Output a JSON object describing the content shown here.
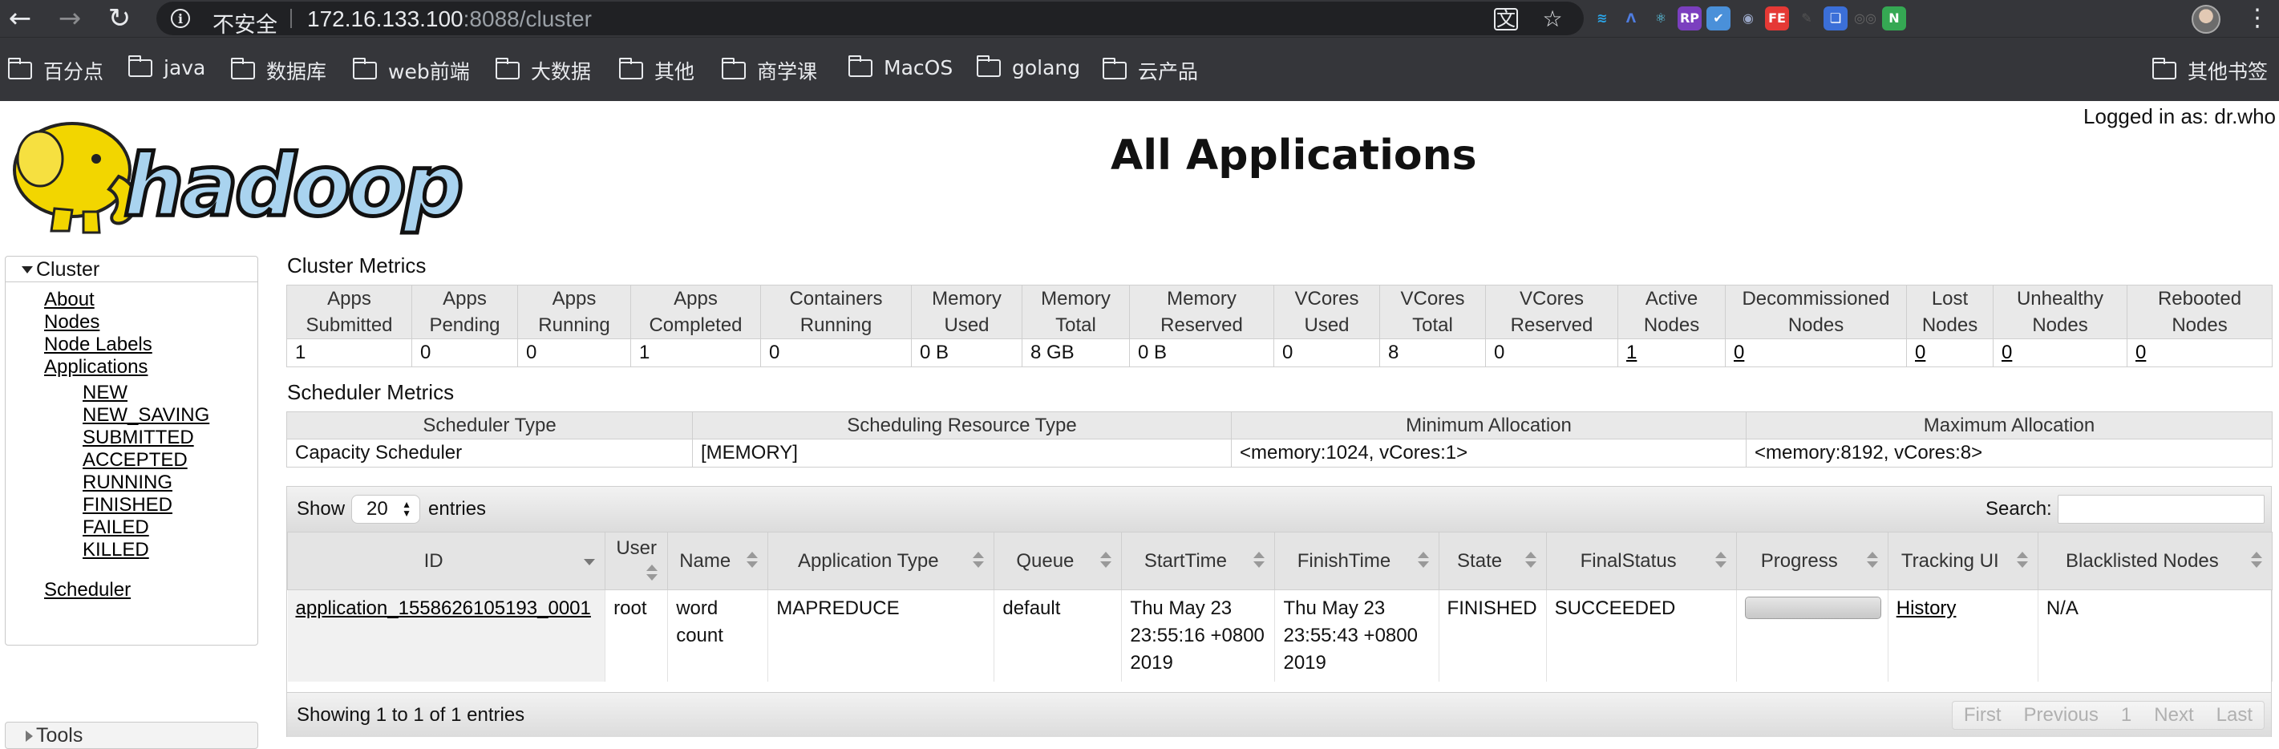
{
  "browser": {
    "address": {
      "insecure_label": "不安全",
      "url_host": "172.16.133.100",
      "url_rest": ":8088/cluster"
    },
    "bookmarks": [
      "百分点",
      "java",
      "数据库",
      "web前端",
      "大数据",
      "其他",
      "商学课",
      "MacOS",
      "golang",
      "云产品"
    ],
    "other_bookmarks": "其他书签",
    "extensions": [
      {
        "icon": "layers-icon",
        "glyph": "≋",
        "color": "#2aa5e8"
      },
      {
        "icon": "lambda-icon",
        "glyph": "Λ",
        "color": "#4f7de0"
      },
      {
        "icon": "react-icon",
        "glyph": "⚛",
        "color": "#61dafb"
      },
      {
        "icon": "rp-icon",
        "glyph": "RP",
        "color": "#7b3fbf"
      },
      {
        "icon": "check-circle-icon",
        "glyph": "✔",
        "color": "#4a90d9"
      },
      {
        "icon": "ring-icon",
        "glyph": "◉",
        "color": "#9aa7c7"
      },
      {
        "icon": "fe-icon",
        "glyph": "FE",
        "color": "#e53935"
      },
      {
        "icon": "color-picker-icon",
        "glyph": "✎",
        "color": "#555"
      },
      {
        "icon": "bookmark-blue-icon",
        "glyph": "❏",
        "color": "#3b6fd8"
      },
      {
        "icon": "glasses-icon",
        "glyph": "◎◎",
        "color": "#666"
      },
      {
        "icon": "n-icon",
        "glyph": "N",
        "color": "#35a853"
      }
    ]
  },
  "header": {
    "logged_in": "Logged in as: dr.who",
    "title": "All Applications",
    "logo_text": "hadoop"
  },
  "sidebar": {
    "cluster_label": "Cluster",
    "links": [
      "About",
      "Nodes",
      "Node Labels",
      "Applications"
    ],
    "app_states": [
      "NEW",
      "NEW_SAVING",
      "SUBMITTED",
      "ACCEPTED",
      "RUNNING",
      "FINISHED",
      "FAILED",
      "KILLED"
    ],
    "scheduler": "Scheduler",
    "tools_label": "Tools"
  },
  "cluster_metrics": {
    "title": "Cluster Metrics",
    "headers": [
      [
        "Apps",
        "Submitted"
      ],
      [
        "Apps",
        "Pending"
      ],
      [
        "Apps",
        "Running"
      ],
      [
        "Apps",
        "Completed"
      ],
      [
        "Containers",
        "Running"
      ],
      [
        "Memory",
        "Used"
      ],
      [
        "Memory",
        "Total"
      ],
      [
        "Memory",
        "Reserved"
      ],
      [
        "VCores",
        "Used"
      ],
      [
        "VCores",
        "Total"
      ],
      [
        "VCores",
        "Reserved"
      ],
      [
        "Active",
        "Nodes"
      ],
      [
        "Decommissioned",
        "Nodes"
      ],
      [
        "Lost",
        "Nodes"
      ],
      [
        "Unhealthy",
        "Nodes"
      ],
      [
        "Rebooted",
        "Nodes"
      ]
    ],
    "values": [
      "1",
      "0",
      "0",
      "1",
      "0",
      "0 B",
      "8 GB",
      "0 B",
      "0",
      "8",
      "0",
      "1",
      "0",
      "0",
      "0",
      "0"
    ]
  },
  "scheduler_metrics": {
    "title": "Scheduler Metrics",
    "headers": [
      "Scheduler Type",
      "Scheduling Resource Type",
      "Minimum Allocation",
      "Maximum Allocation"
    ],
    "values": [
      "Capacity Scheduler",
      "[MEMORY]",
      "<memory:1024, vCores:1>",
      "<memory:8192, vCores:8>"
    ]
  },
  "apps_table": {
    "show_label": "Show",
    "page_length": "20",
    "entries_label": "entries",
    "search_label": "Search:",
    "search_value": "",
    "columns": [
      "ID",
      "User",
      "Name",
      "Application Type",
      "Queue",
      "StartTime",
      "FinishTime",
      "State",
      "FinalStatus",
      "Progress",
      "Tracking UI",
      "Blacklisted Nodes"
    ],
    "rows": [
      {
        "id": "application_1558626105193_0001",
        "user": "root",
        "name": "word count",
        "type": "MAPREDUCE",
        "queue": "default",
        "start": "Thu May 23 23:55:16 +0800 2019",
        "finish": "Thu May 23 23:55:43 +0800 2019",
        "state": "FINISHED",
        "final_status": "SUCCEEDED",
        "progress": 100,
        "tracking": "History",
        "blacklisted": "N/A"
      }
    ],
    "info": "Showing 1 to 1 of 1 entries",
    "pagination": [
      "First",
      "Previous",
      "1",
      "Next",
      "Last"
    ]
  }
}
